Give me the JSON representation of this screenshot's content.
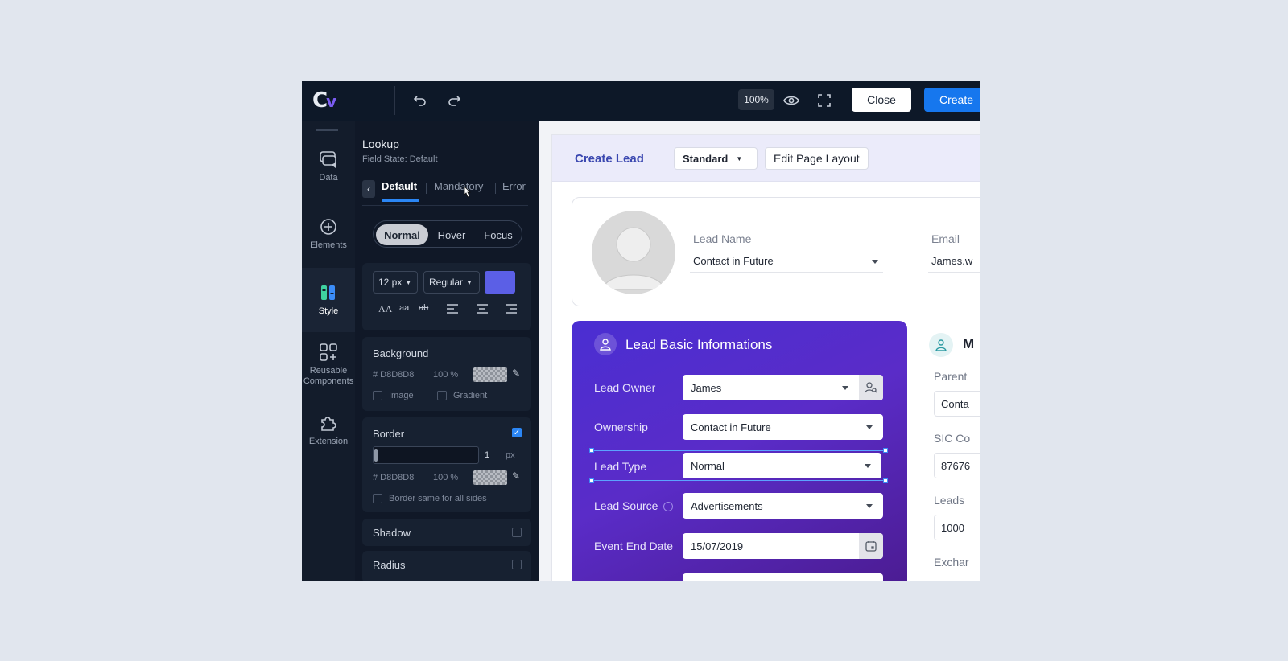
{
  "topbar": {
    "logo": "C",
    "logo_mark": "v",
    "zoom": "100%",
    "close_label": "Close",
    "create_label": "Create"
  },
  "rail": {
    "items": [
      {
        "label": "Data",
        "icon": "data-icon"
      },
      {
        "label": "Elements",
        "icon": "plus-circle-icon"
      },
      {
        "label": "Style",
        "icon": "style-icon",
        "active": true
      },
      {
        "label": "Reusable Components",
        "icon": "components-icon"
      },
      {
        "label": "Extension",
        "icon": "puzzle-icon"
      }
    ]
  },
  "panel": {
    "title": "Lookup",
    "subtitle": "Field State: Default",
    "tabs": [
      "Default",
      "Mandatory",
      "Error"
    ],
    "states": [
      "Normal",
      "Hover",
      "Focus"
    ],
    "font_size": "12 px",
    "font_weight": "Regular",
    "text_color": "#5b5fe6",
    "case_upper": "AA",
    "case_lower": "aa",
    "strike": "ab",
    "background": {
      "label": "Background",
      "hex": "# D8D8D8",
      "opacity": "100 %",
      "image_label": "Image",
      "gradient_label": "Gradient"
    },
    "border": {
      "label": "Border",
      "width": "1",
      "unit": "px",
      "hex": "# D8D8D8",
      "opacity": "100 %",
      "same_label": "Border same for all sides"
    },
    "shadow_label": "Shadow",
    "radius_label": "Radius"
  },
  "page": {
    "title": "Create Lead",
    "layout_select": "Standard",
    "edit_layout": "Edit Page Layout",
    "profile": {
      "lead_name_label": "Lead Name",
      "lead_name_value": "Contact in Future",
      "email_label": "Email",
      "email_value": "James.w"
    },
    "section": {
      "title": "Lead Basic Informations",
      "fields": [
        {
          "label": "Lead Owner",
          "value": "James"
        },
        {
          "label": "Ownership",
          "value": "Contact in Future"
        },
        {
          "label": "Lead Type",
          "value": "Normal"
        },
        {
          "label": "Lead Source",
          "value": "Advertisements"
        },
        {
          "label": "Event End Date",
          "value": "15/07/2019"
        }
      ]
    },
    "right": {
      "heading": "M",
      "fields": [
        {
          "label": "Parent",
          "value": "Conta"
        },
        {
          "label": "SIC Co",
          "value": "87676"
        },
        {
          "label": "Leads",
          "value": "1000"
        },
        {
          "label": "Exchar",
          "value": ""
        }
      ]
    }
  }
}
